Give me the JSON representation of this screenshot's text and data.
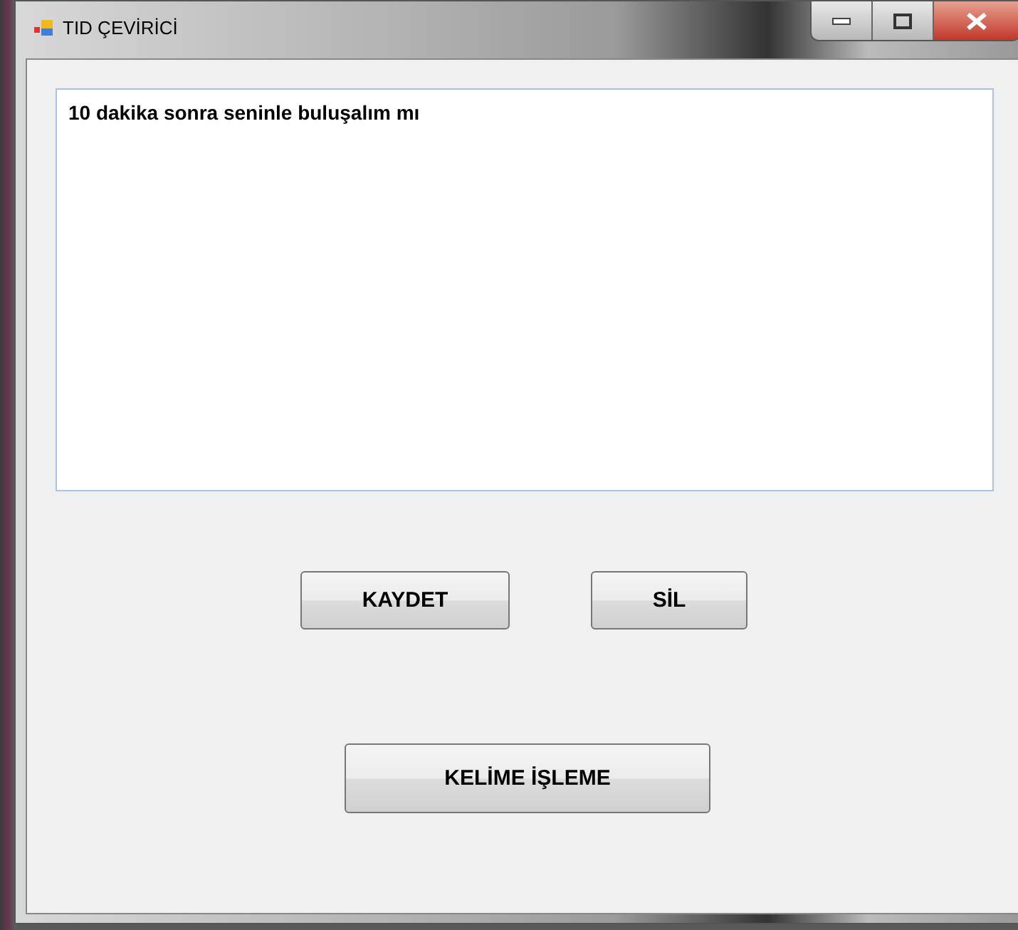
{
  "window": {
    "title": "TID ÇEVİRİCİ"
  },
  "text_area": {
    "value": "10 dakika sonra seninle buluşalım mı"
  },
  "buttons": [
    {
      "label": "KAYDET"
    },
    {
      "label": "SİL"
    },
    {
      "label": "KELİME İŞLEME"
    }
  ]
}
